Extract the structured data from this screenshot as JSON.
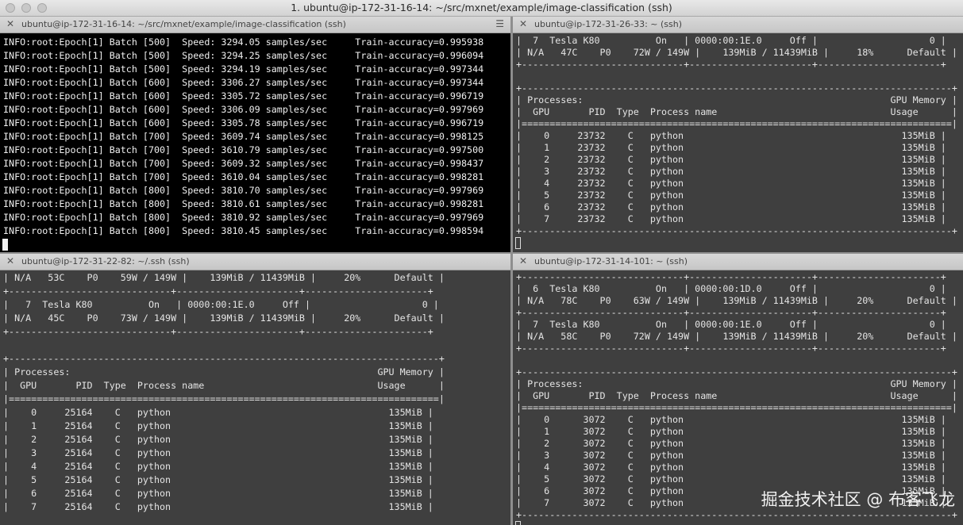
{
  "window": {
    "title": "1. ubuntu@ip-172-31-16-14: ~/src/mxnet/example/image-classification (ssh)"
  },
  "icons": {
    "close": "close-icon",
    "menu": "hamburger-menu-icon"
  },
  "panes": {
    "a": {
      "title": "ubuntu@ip-172-31-16-14: ~/src/mxnet/example/image-classification (ssh)",
      "lines": [
        "INFO:root:Epoch[1] Batch [500]  Speed: 3294.05 samples/sec     Train-accuracy=0.995938",
        "INFO:root:Epoch[1] Batch [500]  Speed: 3294.25 samples/sec     Train-accuracy=0.996094",
        "INFO:root:Epoch[1] Batch [500]  Speed: 3294.19 samples/sec     Train-accuracy=0.997344",
        "INFO:root:Epoch[1] Batch [600]  Speed: 3306.27 samples/sec     Train-accuracy=0.997344",
        "INFO:root:Epoch[1] Batch [600]  Speed: 3305.72 samples/sec     Train-accuracy=0.996719",
        "INFO:root:Epoch[1] Batch [600]  Speed: 3306.09 samples/sec     Train-accuracy=0.997969",
        "INFO:root:Epoch[1] Batch [600]  Speed: 3305.78 samples/sec     Train-accuracy=0.996719",
        "INFO:root:Epoch[1] Batch [700]  Speed: 3609.74 samples/sec     Train-accuracy=0.998125",
        "INFO:root:Epoch[1] Batch [700]  Speed: 3610.79 samples/sec     Train-accuracy=0.997500",
        "INFO:root:Epoch[1] Batch [700]  Speed: 3609.32 samples/sec     Train-accuracy=0.998437",
        "INFO:root:Epoch[1] Batch [700]  Speed: 3610.04 samples/sec     Train-accuracy=0.998281",
        "INFO:root:Epoch[1] Batch [800]  Speed: 3810.70 samples/sec     Train-accuracy=0.997969",
        "INFO:root:Epoch[1] Batch [800]  Speed: 3810.61 samples/sec     Train-accuracy=0.998281",
        "INFO:root:Epoch[1] Batch [800]  Speed: 3810.92 samples/sec     Train-accuracy=0.997969",
        "INFO:root:Epoch[1] Batch [800]  Speed: 3810.45 samples/sec     Train-accuracy=0.998594"
      ]
    },
    "b": {
      "title": "ubuntu@ip-172-31-26-33: ~ (ssh)",
      "lines": [
        "|  7  Tesla K80          On   | 0000:00:1E.0     Off |                    0 |",
        "| N/A   47C    P0    72W / 149W |    139MiB / 11439MiB |     18%      Default |",
        "+-----------------------------+----------------------+----------------------+",
        "",
        "+-----------------------------------------------------------------------------+",
        "| Processes:                                                       GPU Memory |",
        "|  GPU       PID  Type  Process name                               Usage      |",
        "|=============================================================================|",
        "|    0     23732    C   python                                       135MiB |",
        "|    1     23732    C   python                                       135MiB |",
        "|    2     23732    C   python                                       135MiB |",
        "|    3     23732    C   python                                       135MiB |",
        "|    4     23732    C   python                                       135MiB |",
        "|    5     23732    C   python                                       135MiB |",
        "|    6     23732    C   python                                       135MiB |",
        "|    7     23732    C   python                                       135MiB |",
        "+-----------------------------------------------------------------------------+"
      ]
    },
    "c": {
      "title": "ubuntu@ip-172-31-22-82: ~/.ssh (ssh)",
      "lines": [
        "| N/A   53C    P0    59W / 149W |    139MiB / 11439MiB |     20%      Default |",
        "+-----------------------------+----------------------+----------------------+",
        "|   7  Tesla K80          On   | 0000:00:1E.0     Off |                    0 |",
        "| N/A   45C    P0    73W / 149W |    139MiB / 11439MiB |     20%      Default |",
        "+-----------------------------+----------------------+----------------------+",
        "",
        "+-----------------------------------------------------------------------------+",
        "| Processes:                                                       GPU Memory |",
        "|  GPU       PID  Type  Process name                               Usage      |",
        "|=============================================================================|",
        "|    0     25164    C   python                                       135MiB |",
        "|    1     25164    C   python                                       135MiB |",
        "|    2     25164    C   python                                       135MiB |",
        "|    3     25164    C   python                                       135MiB |",
        "|    4     25164    C   python                                       135MiB |",
        "|    5     25164    C   python                                       135MiB |",
        "|    6     25164    C   python                                       135MiB |",
        "|    7     25164    C   python                                       135MiB |"
      ]
    },
    "d": {
      "title": "ubuntu@ip-172-31-14-101: ~ (ssh)",
      "lines": [
        "+-----------------------------+----------------------+----------------------+",
        "|  6  Tesla K80          On   | 0000:00:1D.0     Off |                    0 |",
        "| N/A   78C    P0    63W / 149W |    139MiB / 11439MiB |     20%      Default |",
        "+-----------------------------+----------------------+----------------------+",
        "|  7  Tesla K80          On   | 0000:00:1E.0     Off |                    0 |",
        "| N/A   58C    P0    72W / 149W |    139MiB / 11439MiB |     20%      Default |",
        "+-----------------------------+----------------------+----------------------+",
        "",
        "+-----------------------------------------------------------------------------+",
        "| Processes:                                                       GPU Memory |",
        "|  GPU       PID  Type  Process name                               Usage      |",
        "|=============================================================================|",
        "|    0      3072    C   python                                       135MiB |",
        "|    1      3072    C   python                                       135MiB |",
        "|    2      3072    C   python                                       135MiB |",
        "|    3      3072    C   python                                       135MiB |",
        "|    4      3072    C   python                                       135MiB |",
        "|    5      3072    C   python                                       135MiB |",
        "|    6      3072    C   python                                       135MiB |",
        "|    7      3072    C   python                                       135MiB |",
        "+-----------------------------------------------------------------------------+"
      ]
    }
  },
  "watermark": "掘金技术社区 @ 布客飞龙"
}
